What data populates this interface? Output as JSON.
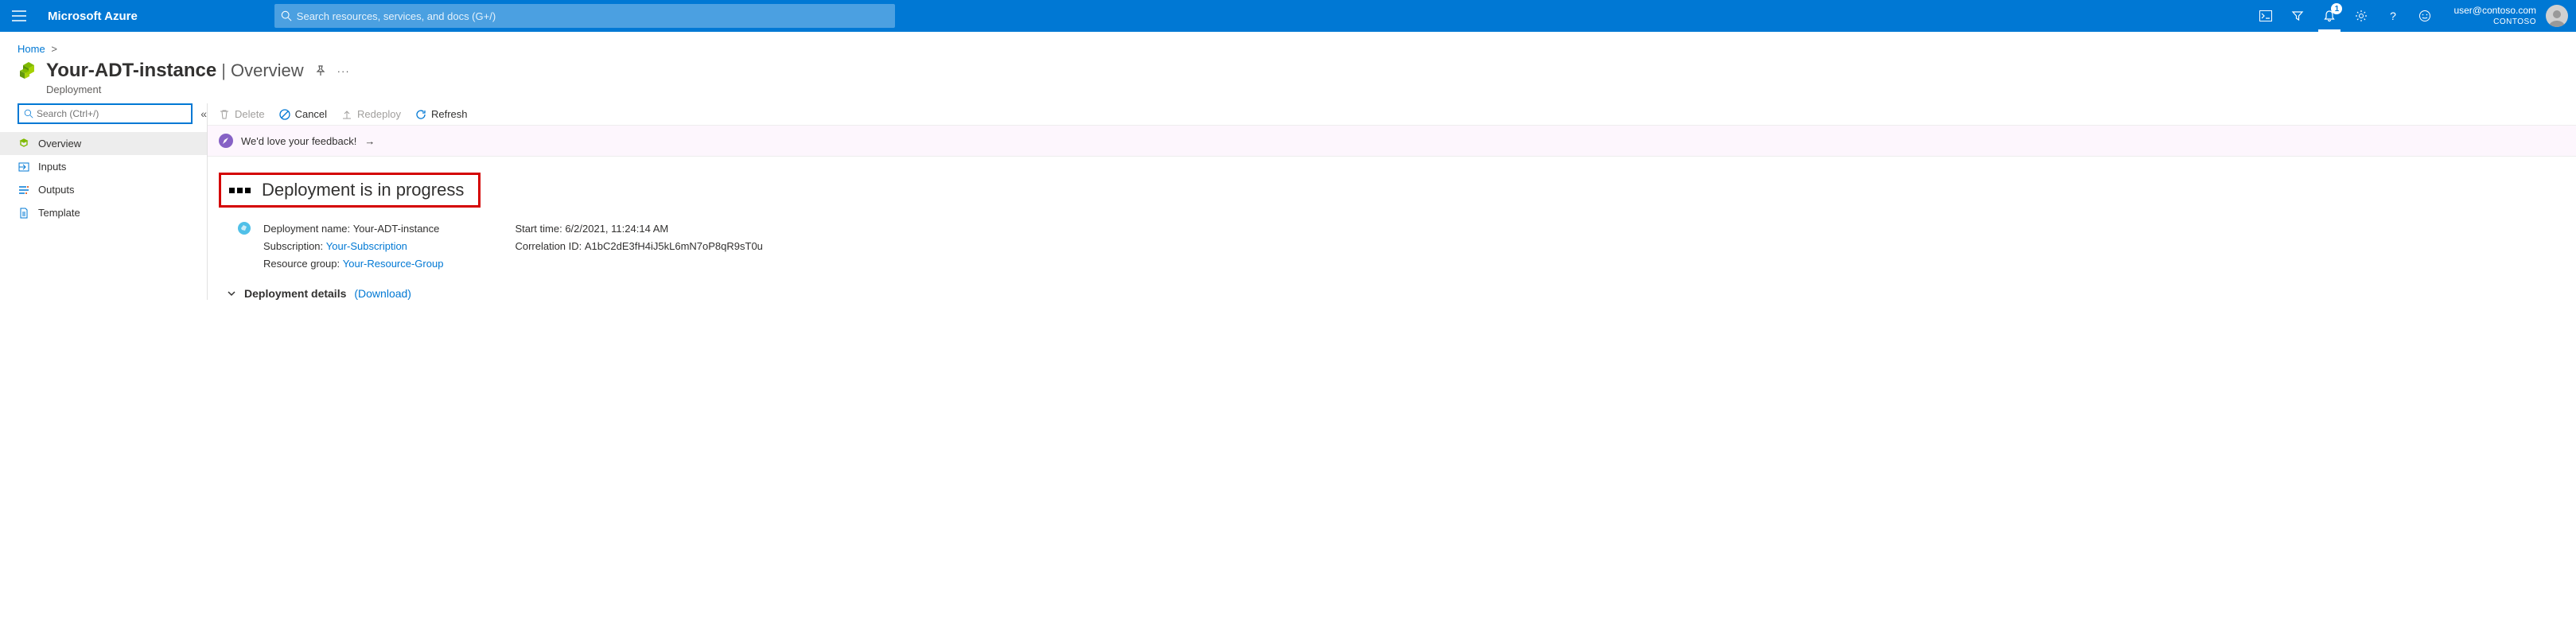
{
  "header": {
    "brand": "Microsoft Azure",
    "search_placeholder": "Search resources, services, and docs (G+/)",
    "notif_count": "1",
    "user_email": "user@contoso.com",
    "tenant": "CONTOSO"
  },
  "breadcrumb": {
    "home": "Home"
  },
  "title": {
    "name": "Your-ADT-instance",
    "section": "Overview",
    "kind": "Deployment"
  },
  "sidebar": {
    "search_placeholder": "Search (Ctrl+/)",
    "items": [
      {
        "label": "Overview"
      },
      {
        "label": "Inputs"
      },
      {
        "label": "Outputs"
      },
      {
        "label": "Template"
      }
    ]
  },
  "toolbar": {
    "delete": "Delete",
    "cancel": "Cancel",
    "redeploy": "Redeploy",
    "refresh": "Refresh"
  },
  "feedback": {
    "text": "We'd love your feedback!"
  },
  "status": {
    "text": "Deployment is in progress"
  },
  "details": {
    "left": {
      "dep_name_label": "Deployment name:",
      "dep_name_value": "Your-ADT-instance",
      "sub_label": "Subscription:",
      "sub_value": "Your-Subscription",
      "rg_label": "Resource group:",
      "rg_value": "Your-Resource-Group"
    },
    "right": {
      "start_label": "Start time:",
      "start_value": "6/2/2021, 11:24:14 AM",
      "corr_label": "Correlation ID:",
      "corr_value": "A1bC2dE3fH4iJ5kL6mN7oP8qR9sT0u"
    }
  },
  "deployment_details": {
    "label": "Deployment details",
    "download": "(Download)"
  }
}
